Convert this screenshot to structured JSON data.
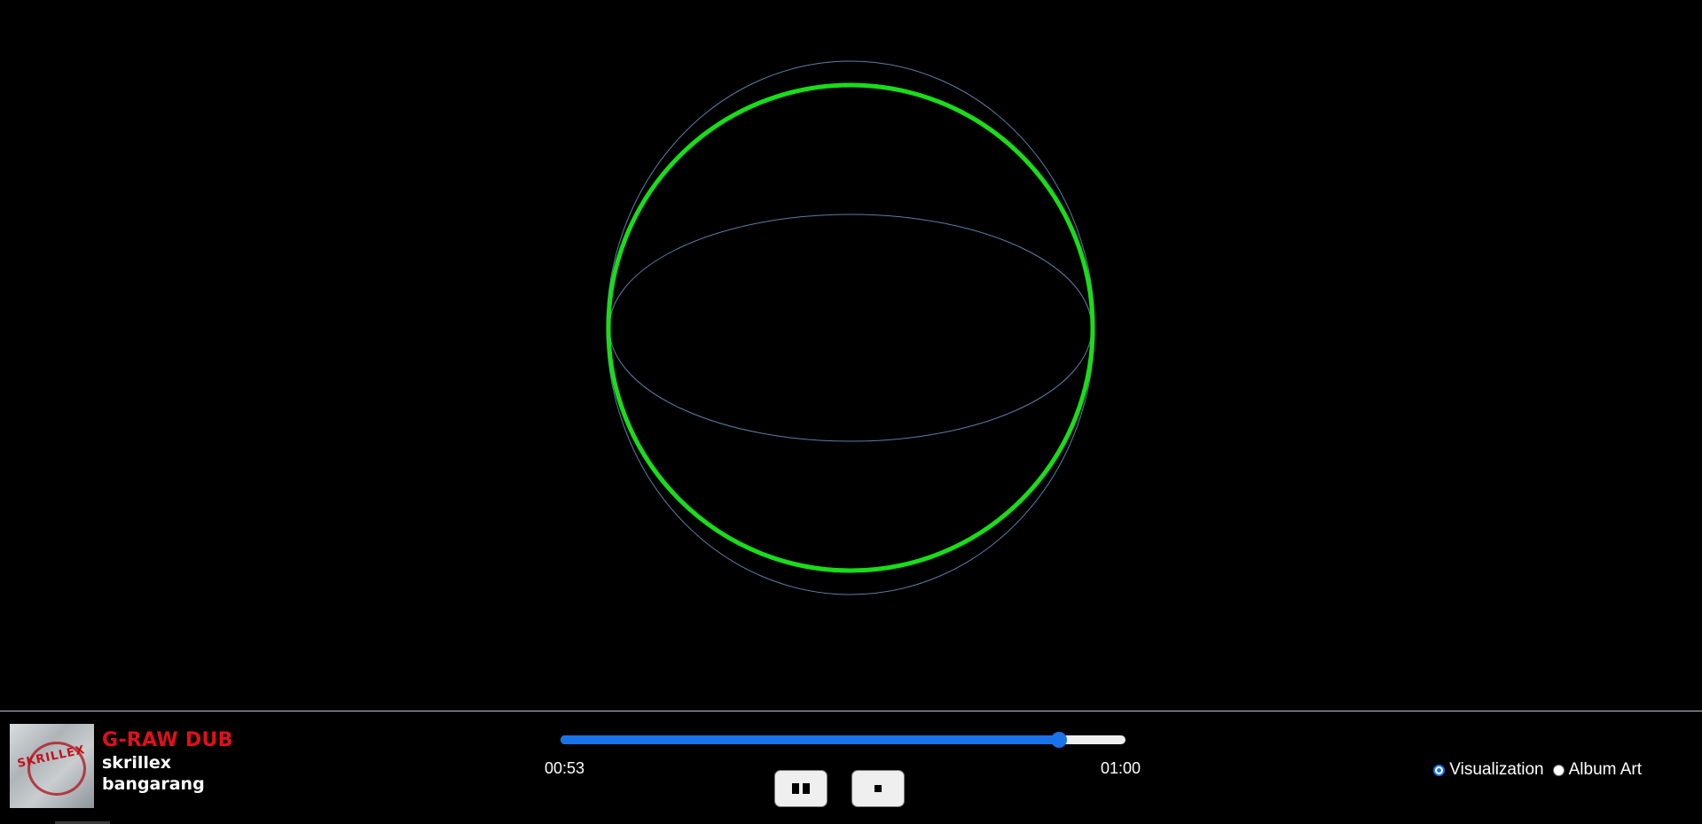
{
  "visualizer": {
    "ring_color": "#19dd19",
    "wire_color": "#5a7fa6",
    "background": "#000000"
  },
  "now_playing": {
    "album_art_icon": "album-art-image",
    "title": "G-RAW DUB",
    "artist": "skrillex",
    "album": "bangarang",
    "title_color": "#e0101a"
  },
  "playback": {
    "current_time": "00:53",
    "total_time": "01:00",
    "progress": 0.883,
    "accent_color": "#1a73e8",
    "pause_icon": "pause-icon",
    "stop_icon": "stop-icon"
  },
  "view_mode": {
    "options": [
      {
        "label": "Visualization",
        "selected": true
      },
      {
        "label": "Album Art",
        "selected": false
      }
    ]
  }
}
